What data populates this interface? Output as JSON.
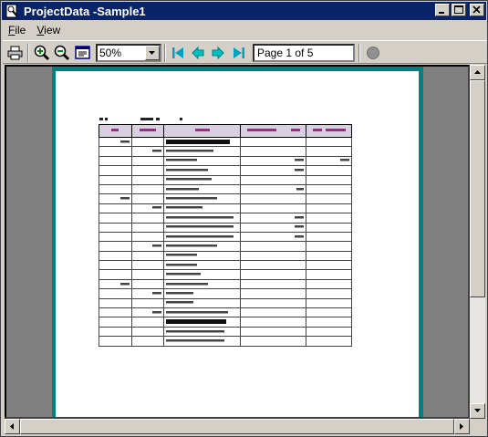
{
  "window": {
    "title": "ProjectData -Sample1"
  },
  "menu": {
    "file": "File",
    "file_accel": "F",
    "file_rest": "ile",
    "view": "View",
    "view_accel": "V",
    "view_rest": "iew"
  },
  "toolbar": {
    "zoom_value": "50%",
    "page_indicator": "Page 1 of 5"
  },
  "colors": {
    "titlebar": "#0a246a",
    "page_border": "#008080",
    "header_text": "#b0208a"
  },
  "icons": [
    "printer-icon",
    "zoom-in-icon",
    "zoom-out-icon",
    "page-view-icon",
    "first-page-icon",
    "prev-page-icon",
    "next-page-icon",
    "last-page-icon",
    "stop-icon"
  ]
}
